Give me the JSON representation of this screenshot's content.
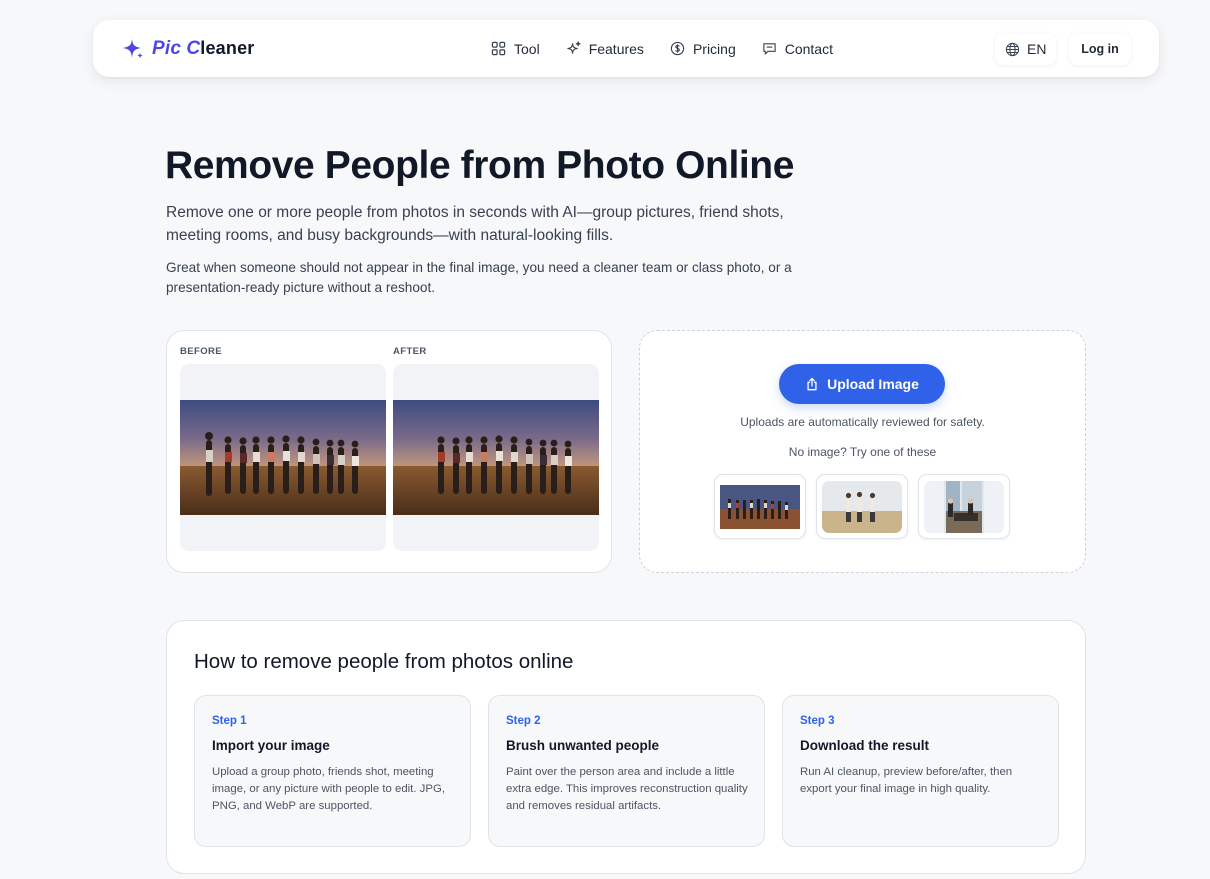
{
  "header": {
    "brand_first": "Pic",
    "brand_second": "Cleaner",
    "nav": [
      {
        "label": "Tool",
        "icon": "grid-icon"
      },
      {
        "label": "Features",
        "icon": "sparkles-icon"
      },
      {
        "label": "Pricing",
        "icon": "dollar-circle-icon"
      },
      {
        "label": "Contact",
        "icon": "chat-bubble-icon"
      }
    ],
    "language": "EN",
    "login_label": "Log in"
  },
  "hero": {
    "title": "Remove People from Photo Online",
    "subtitle": "Remove one or more people from photos in seconds with AI—group pictures, friend shots, meeting rooms, and busy backgrounds—with natural-looking fills.",
    "description": "Great when someone should not appear in the final image, you need a cleaner team or class photo, or a presentation-ready picture without a reshoot."
  },
  "compare": {
    "before_label": "BEFORE",
    "after_label": "AFTER"
  },
  "upload": {
    "button_label": "Upload Image",
    "note": "Uploads are automatically reviewed for safety.",
    "sample_prompt": "No image? Try one of these",
    "samples": [
      "group-sunset-photo",
      "group-field-photo",
      "meeting-room-photo"
    ]
  },
  "howto": {
    "title": "How to remove people from photos online",
    "steps": [
      {
        "tag": "Step 1",
        "title": "Import your image",
        "desc": "Upload a group photo, friends shot, meeting image, or any picture with people to edit. JPG, PNG, and WebP are supported."
      },
      {
        "tag": "Step 2",
        "title": "Brush unwanted people",
        "desc": "Paint over the person area and include a little extra edge. This improves reconstruction quality and removes residual artifacts."
      },
      {
        "tag": "Step 3",
        "title": "Download the result",
        "desc": "Run AI cleanup, preview before/after, then export your final image in high quality."
      }
    ]
  },
  "colors": {
    "primary": "#2f62e8",
    "brand_accent": "#4f46e5",
    "background": "#f7f8fa",
    "text": "#111827"
  }
}
